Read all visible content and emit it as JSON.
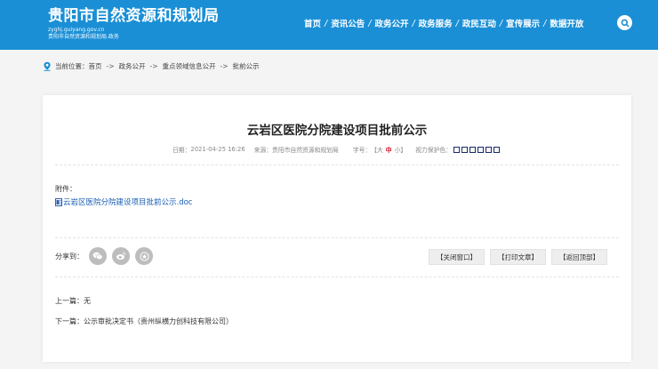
{
  "header": {
    "site_title": "贵阳市自然资源和规划局",
    "domain": "zyghj.guiyang.gov.cn",
    "subtitle": "贵阳市自然资源和规划局.政务",
    "nav": [
      "首页",
      "资讯公告",
      "政务公开",
      "政务服务",
      "政民互动",
      "宣传展示",
      "数据开放"
    ],
    "nav_separator": "/",
    "search_icon": "search-icon"
  },
  "breadcrumb": {
    "prefix": "当前位置：",
    "items": [
      "首页",
      "政务公开",
      "重点领域信息公开",
      "批前公示"
    ],
    "separator": "->"
  },
  "article": {
    "title": "云岩区医院分院建设项目批前公示",
    "date_label": "日期：",
    "date": "2021-04-25 16:26",
    "source_label": "来源：",
    "source": "贵阳市自然资源和规划局",
    "font_size_label": "字号：",
    "font_size_open": "【",
    "font_size_large": "大",
    "font_size_medium": "中",
    "font_size_small": "小",
    "font_size_close": "】",
    "eye_protect_label": "视力保护色：",
    "eye_protect_colors": [
      "#ffffff",
      "#fafff4",
      "#f7f7f0",
      "#eef6fb",
      "#f7f1f6",
      "#f3f3f3"
    ],
    "attachment_label": "附件：",
    "attachment_file": "云岩区医院分院建设项目批前公示.doc"
  },
  "share": {
    "label": "分享到：",
    "icons": [
      "wechat-icon",
      "weibo-icon",
      "favorite-icon"
    ]
  },
  "actions": {
    "close": "【关闭窗口】",
    "print": "【打印文章】",
    "top": "【返回顶部】"
  },
  "pagination": {
    "prev_label": "上一篇：",
    "prev_value": "无",
    "next_label": "下一篇：",
    "next_value": "公示审批决定书（贵州纵横力创科技有限公司）"
  },
  "colors": {
    "header_bg": "#1a8fd6",
    "accent_red": "#d0021b",
    "link_blue": "#1a5fb4"
  }
}
